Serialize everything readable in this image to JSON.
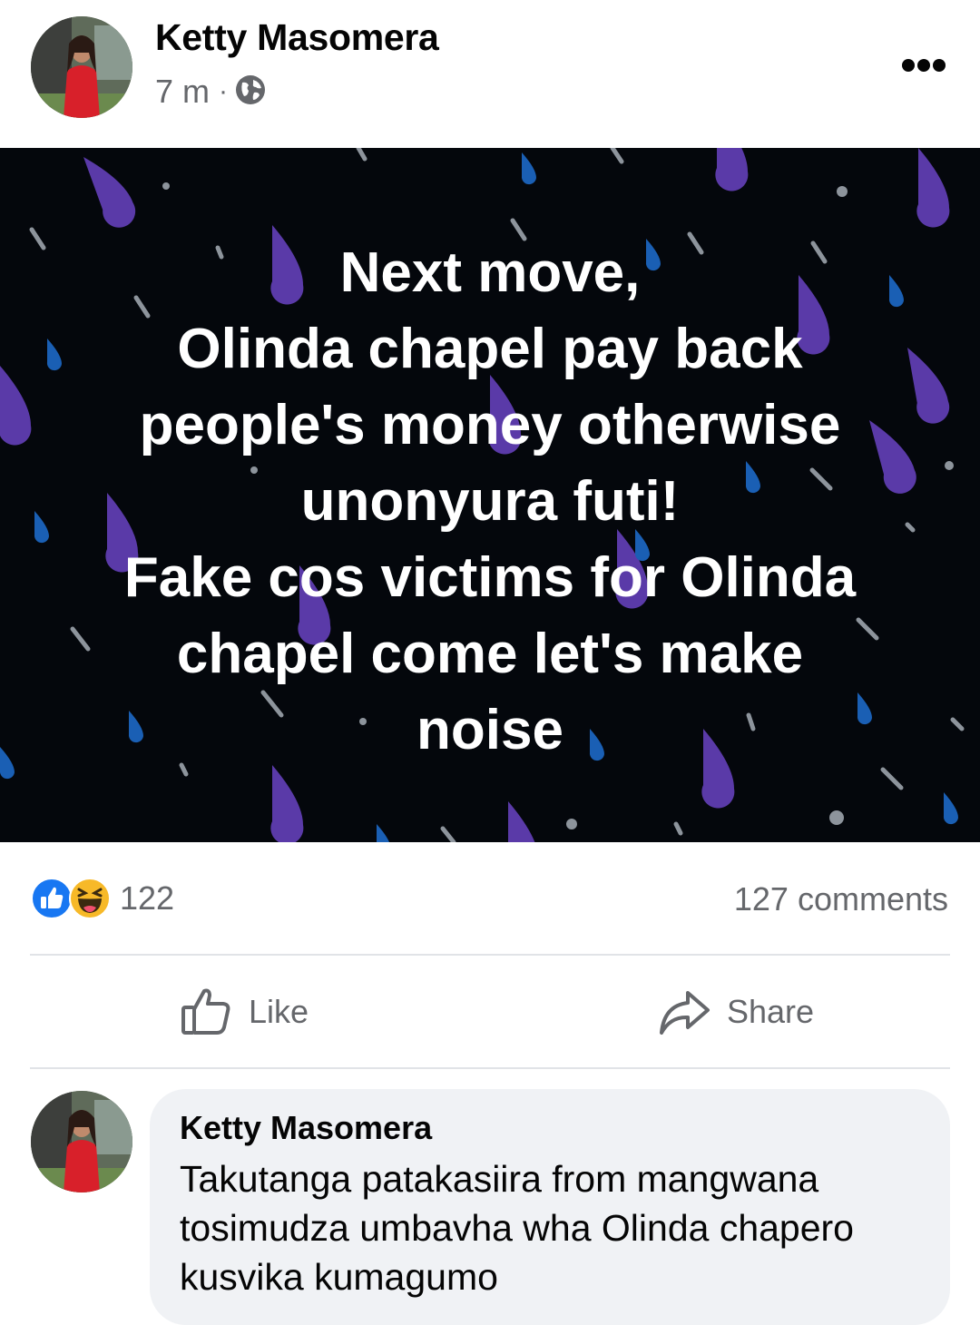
{
  "post": {
    "author": "Ketty Masomera",
    "time": "7 m",
    "separator": "·",
    "privacy_icon": "globe-icon",
    "more_icon": "more-horizontal-icon",
    "image_text": "Next move,\nOlinda chapel pay back\npeople's money otherwise\nunonyura futi!\nFake cos victims for Olinda\nchapel come let's make\nnoise"
  },
  "reactions": {
    "icons": [
      "like-reaction-icon",
      "haha-reaction-icon"
    ],
    "count": "122",
    "comments": "127 comments"
  },
  "actions": {
    "like": "Like",
    "share": "Share"
  },
  "comment": {
    "author": "Ketty Masomera",
    "text": "Takutanga patakasiira from mangwana\ntosimudza umbavha wha Olinda chapero\nkusvika kumagumo"
  },
  "colors": {
    "like_blue": "#1877f2",
    "secondary_text": "#65676b",
    "image_background": "#04070c",
    "raindrop_purple": "#5a3aa8",
    "raindrop_blue": "#1a5fb4",
    "comment_bubble": "#f0f2f5"
  }
}
